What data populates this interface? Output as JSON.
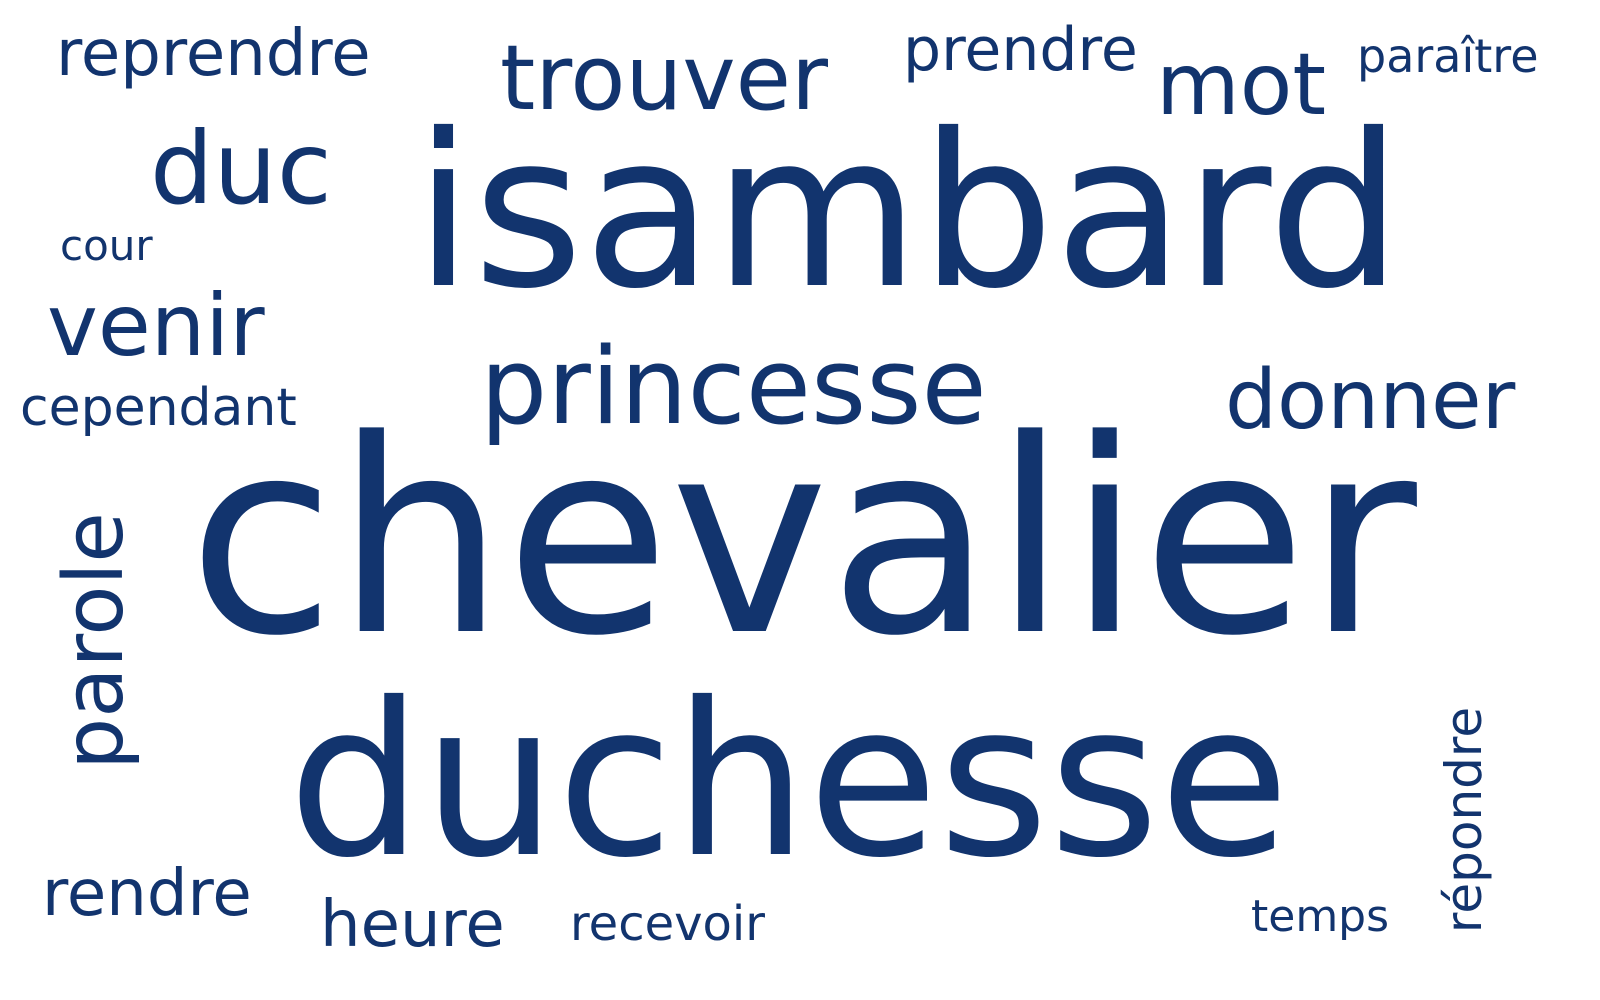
{
  "colors": {
    "background": "#ffffff",
    "word": "#12346e"
  },
  "words": {
    "chevalier": "chevalier",
    "isambard": "isambard",
    "duchesse": "duchesse",
    "princesse": "princesse",
    "trouver": "trouver",
    "mot": "mot",
    "reprendre": "reprendre",
    "prendre": "prendre",
    "paraitre": "paraître",
    "duc": "duc",
    "cour": "cour",
    "venir": "venir",
    "cependant": "cependant",
    "donner": "donner",
    "parole": "parole",
    "rendre": "rendre",
    "heure": "heure",
    "recevoir": "recevoir",
    "temps": "temps",
    "repondre": "répondre"
  }
}
